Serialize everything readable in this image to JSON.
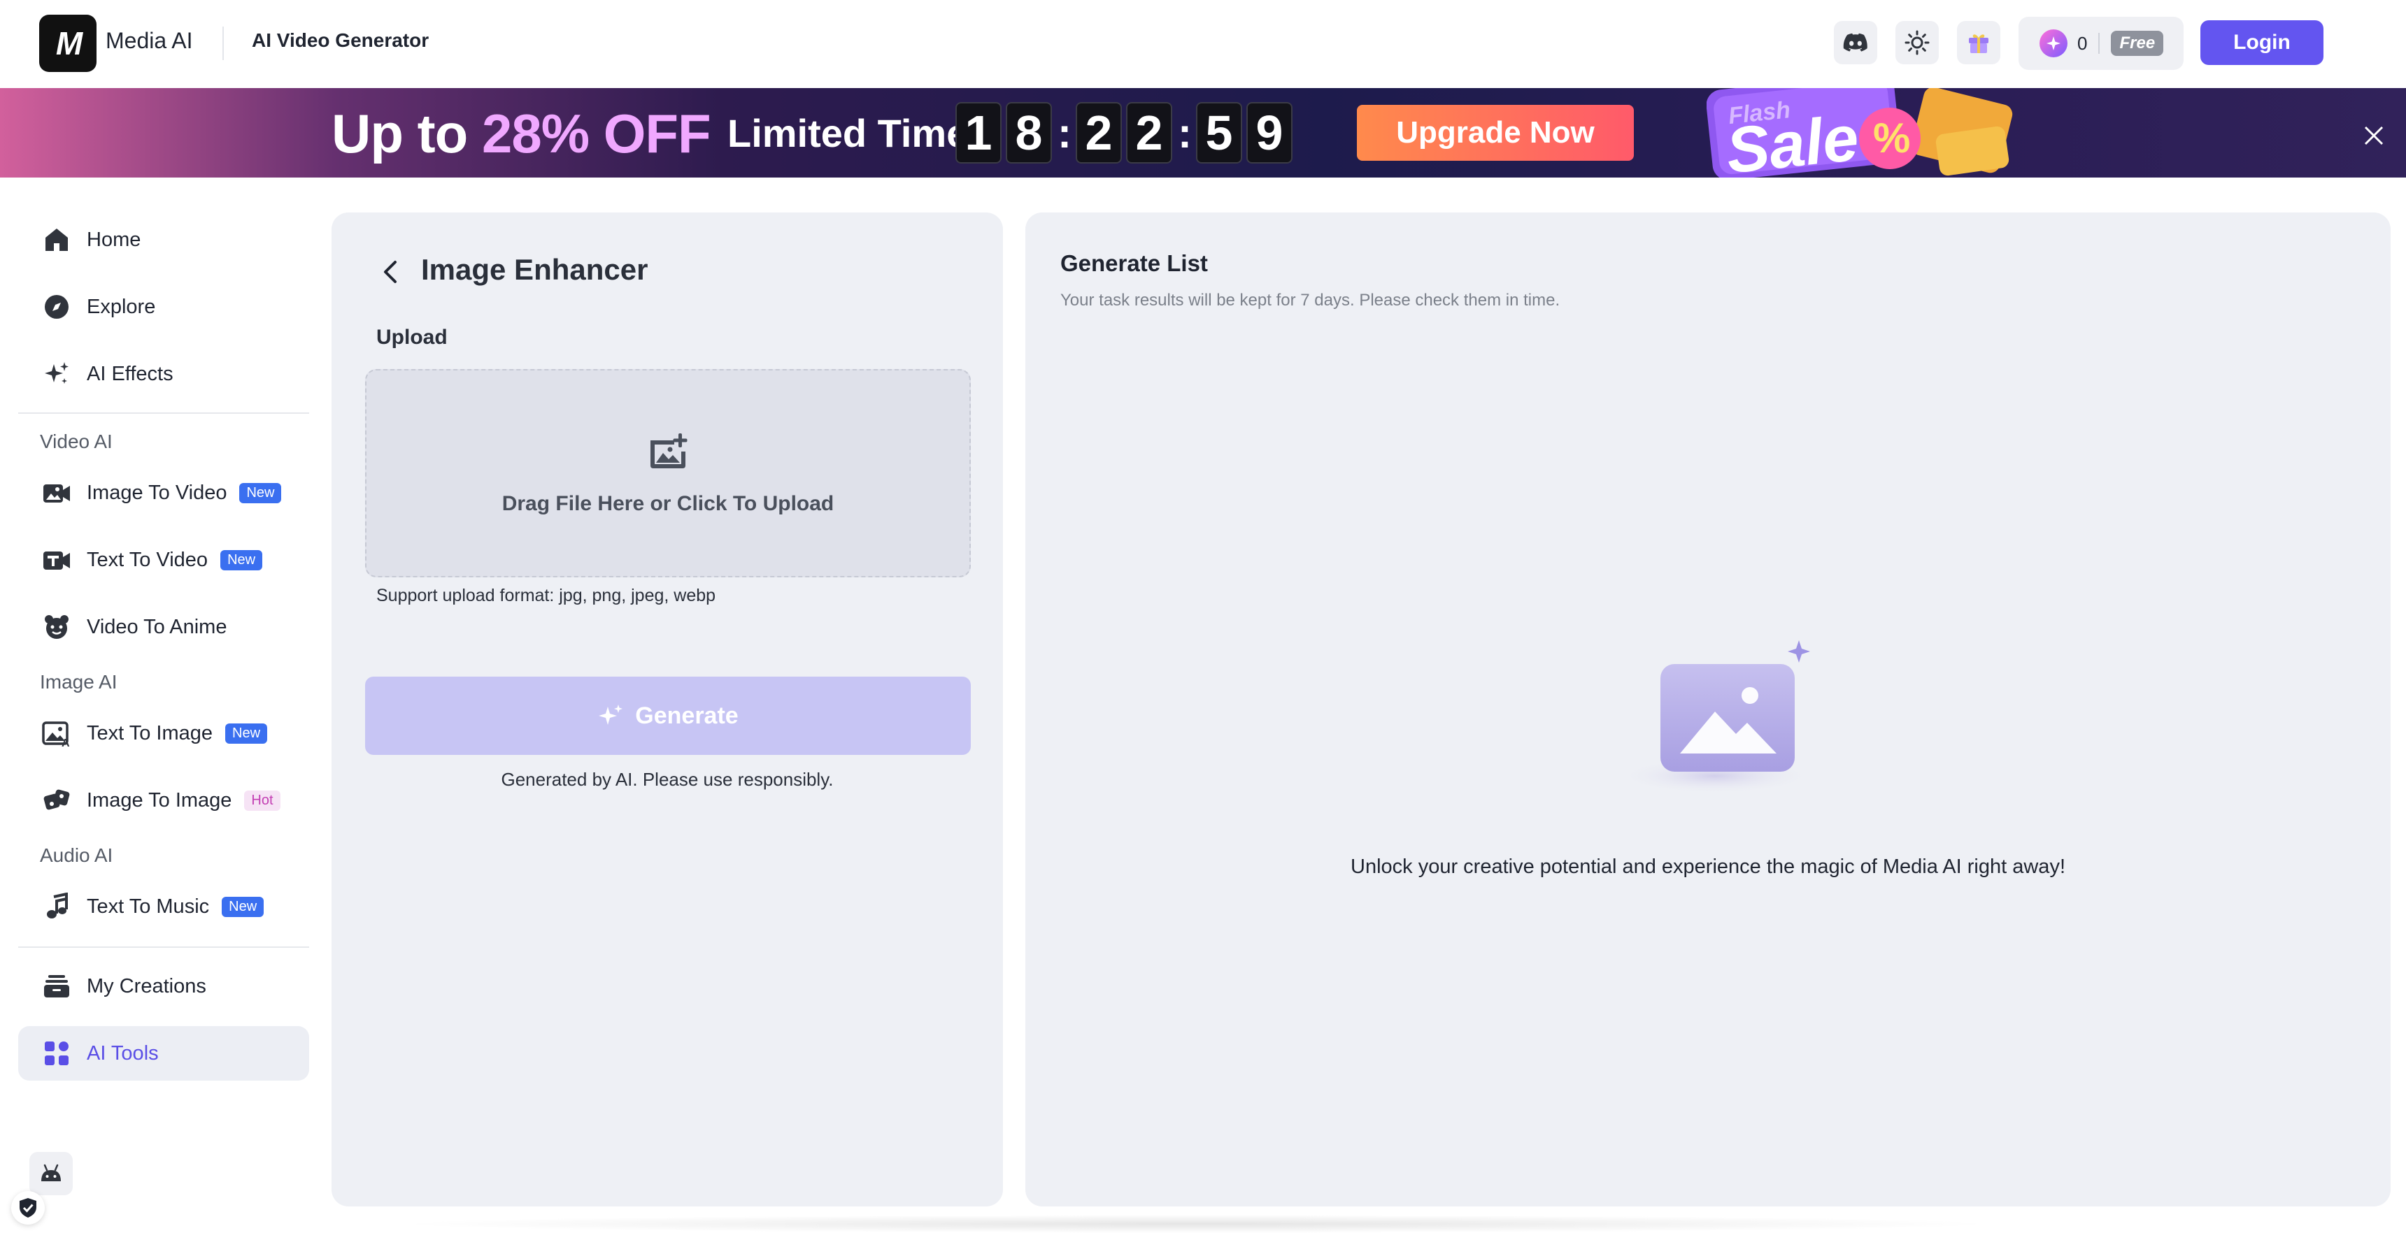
{
  "header": {
    "logo_text": "M",
    "brand_name": "Media AI",
    "app_title": "AI Video Generator",
    "credits": "0",
    "plan": "Free",
    "login_label": "Login"
  },
  "banner": {
    "headline_prefix": "Up to ",
    "headline_percent": "28% OFF",
    "limited": "Limited Time",
    "countdown": {
      "d1": "1",
      "d2": "8",
      "d3": "2",
      "d4": "2",
      "d5": "5",
      "d6": "9"
    },
    "upgrade_label": "Upgrade Now",
    "sale_art_text1": "Flash",
    "sale_art_text2": "Sale",
    "sale_art_text3": "%"
  },
  "sidebar": {
    "home": "Home",
    "explore": "Explore",
    "ai_effects": "AI Effects",
    "video_ai_title": "Video AI",
    "image_to_video": "Image To Video",
    "image_to_video_tag": "New",
    "text_to_video": "Text To Video",
    "text_to_video_tag": "New",
    "video_to_anime": "Video To Anime",
    "image_ai_title": "Image AI",
    "text_to_image": "Text To Image",
    "text_to_image_tag": "New",
    "image_to_image": "Image To Image",
    "image_to_image_tag": "Hot",
    "audio_ai_title": "Audio AI",
    "text_to_music": "Text To Music",
    "text_to_music_tag": "New",
    "my_creations": "My Creations",
    "ai_tools": "AI Tools"
  },
  "tool": {
    "title": "Image Enhancer",
    "upload_label": "Upload",
    "drop_text": "Drag File Here or Click To Upload",
    "support_text": "Support upload format: jpg, png, jpeg, webp",
    "generate_label": "Generate",
    "disclaimer": "Generated by AI. Please use responsibly."
  },
  "list": {
    "title": "Generate List",
    "subtitle": "Your task results will be kept for 7 days. Please check them in time.",
    "empty_text": "Unlock your creative potential and experience the magic of Media AI right away!"
  },
  "colors": {
    "accent": "#6355f0",
    "panel_bg": "#eef0f5",
    "generate_disabled": "#c7c5f4",
    "tag_new": "#3a6ff0",
    "tag_hot": "#c33fb3"
  },
  "icons": {
    "discord": "discord-icon",
    "theme": "sun-icon",
    "gift": "gift-icon",
    "close": "close-icon",
    "back": "chevron-left-icon",
    "upload": "image-add-icon",
    "sparkle": "sparkle-icon"
  }
}
